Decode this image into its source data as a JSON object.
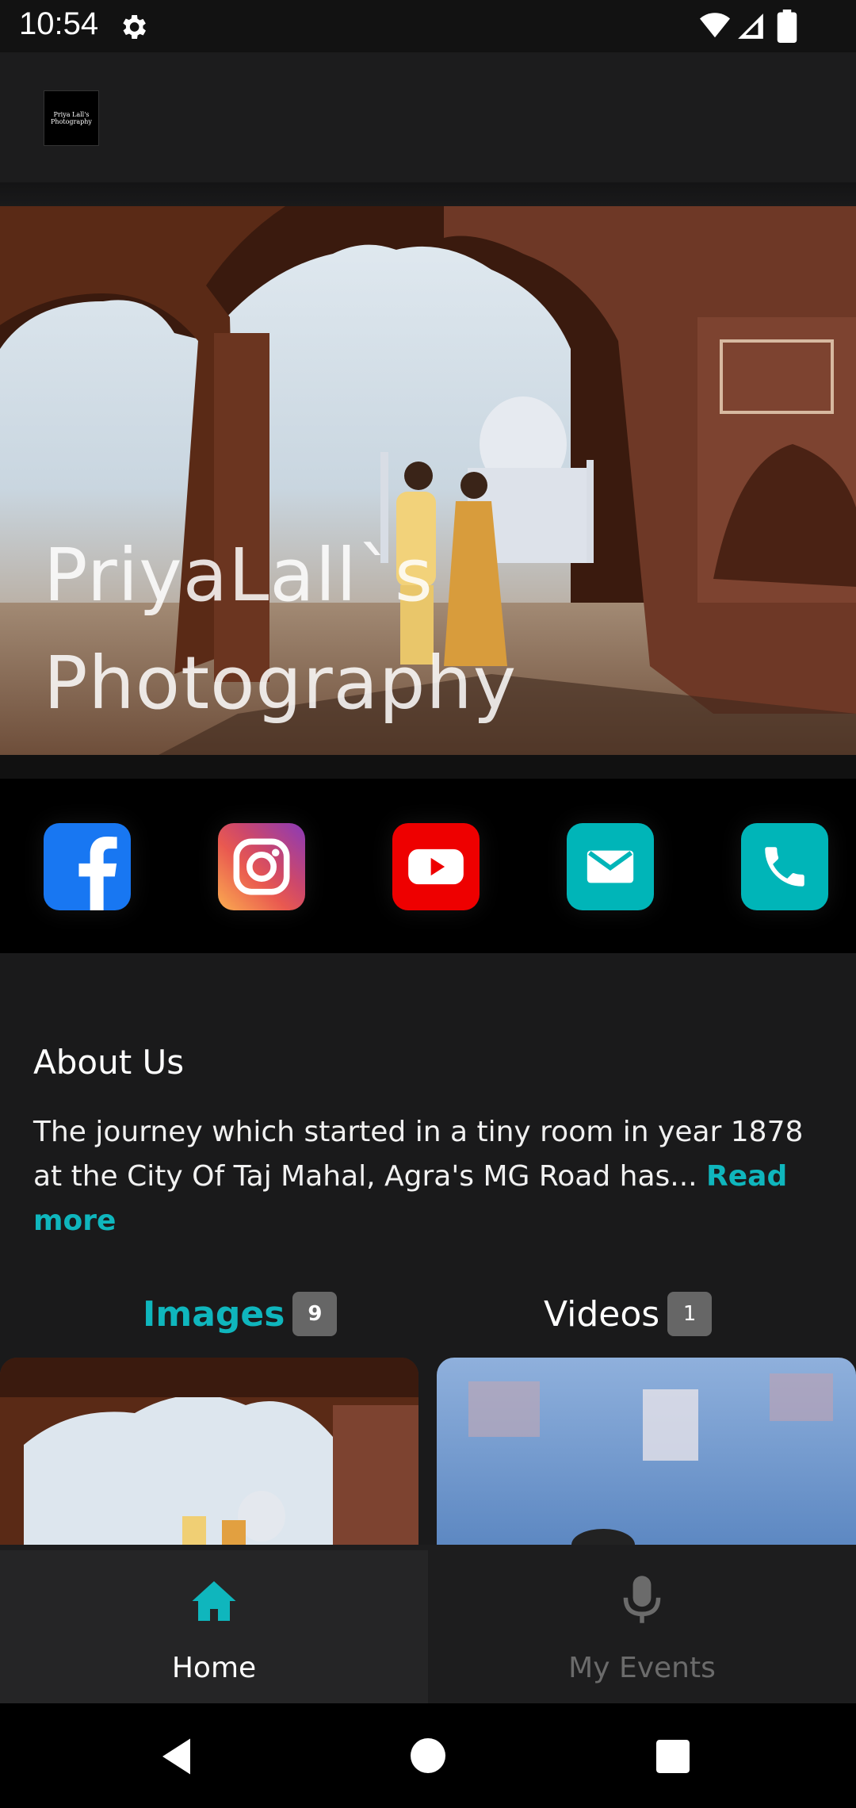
{
  "status_bar": {
    "time": "10:54",
    "icons": [
      "gear-icon",
      "wifi-icon",
      "signal-icon",
      "battery-icon"
    ]
  },
  "app": {
    "logo_lines": [
      "Priya Lall's",
      "Photography"
    ]
  },
  "hero": {
    "title_line1": "PriyaLall`s",
    "title_line2": "Photography"
  },
  "social": [
    {
      "name": "facebook",
      "color": "#1877f2"
    },
    {
      "name": "instagram",
      "color": "#d62976"
    },
    {
      "name": "youtube",
      "color": "#ff0000"
    },
    {
      "name": "email",
      "color": "#00b5b8"
    },
    {
      "name": "phone",
      "color": "#00b5b8"
    }
  ],
  "about": {
    "title": "About Us",
    "text": "The journey which started in a tiny room in year 1878 at the City Of Taj Mahal, Agra's MG Road has... ",
    "read_more": "Read more"
  },
  "tabs": [
    {
      "label": "Images",
      "count": "9",
      "active": true
    },
    {
      "label": "Videos",
      "count": "1",
      "active": false
    }
  ],
  "bottom_nav": {
    "home": "Home",
    "events": "My Events"
  },
  "colors": {
    "accent": "#0fb6bd",
    "background": "#1a1a1b"
  }
}
